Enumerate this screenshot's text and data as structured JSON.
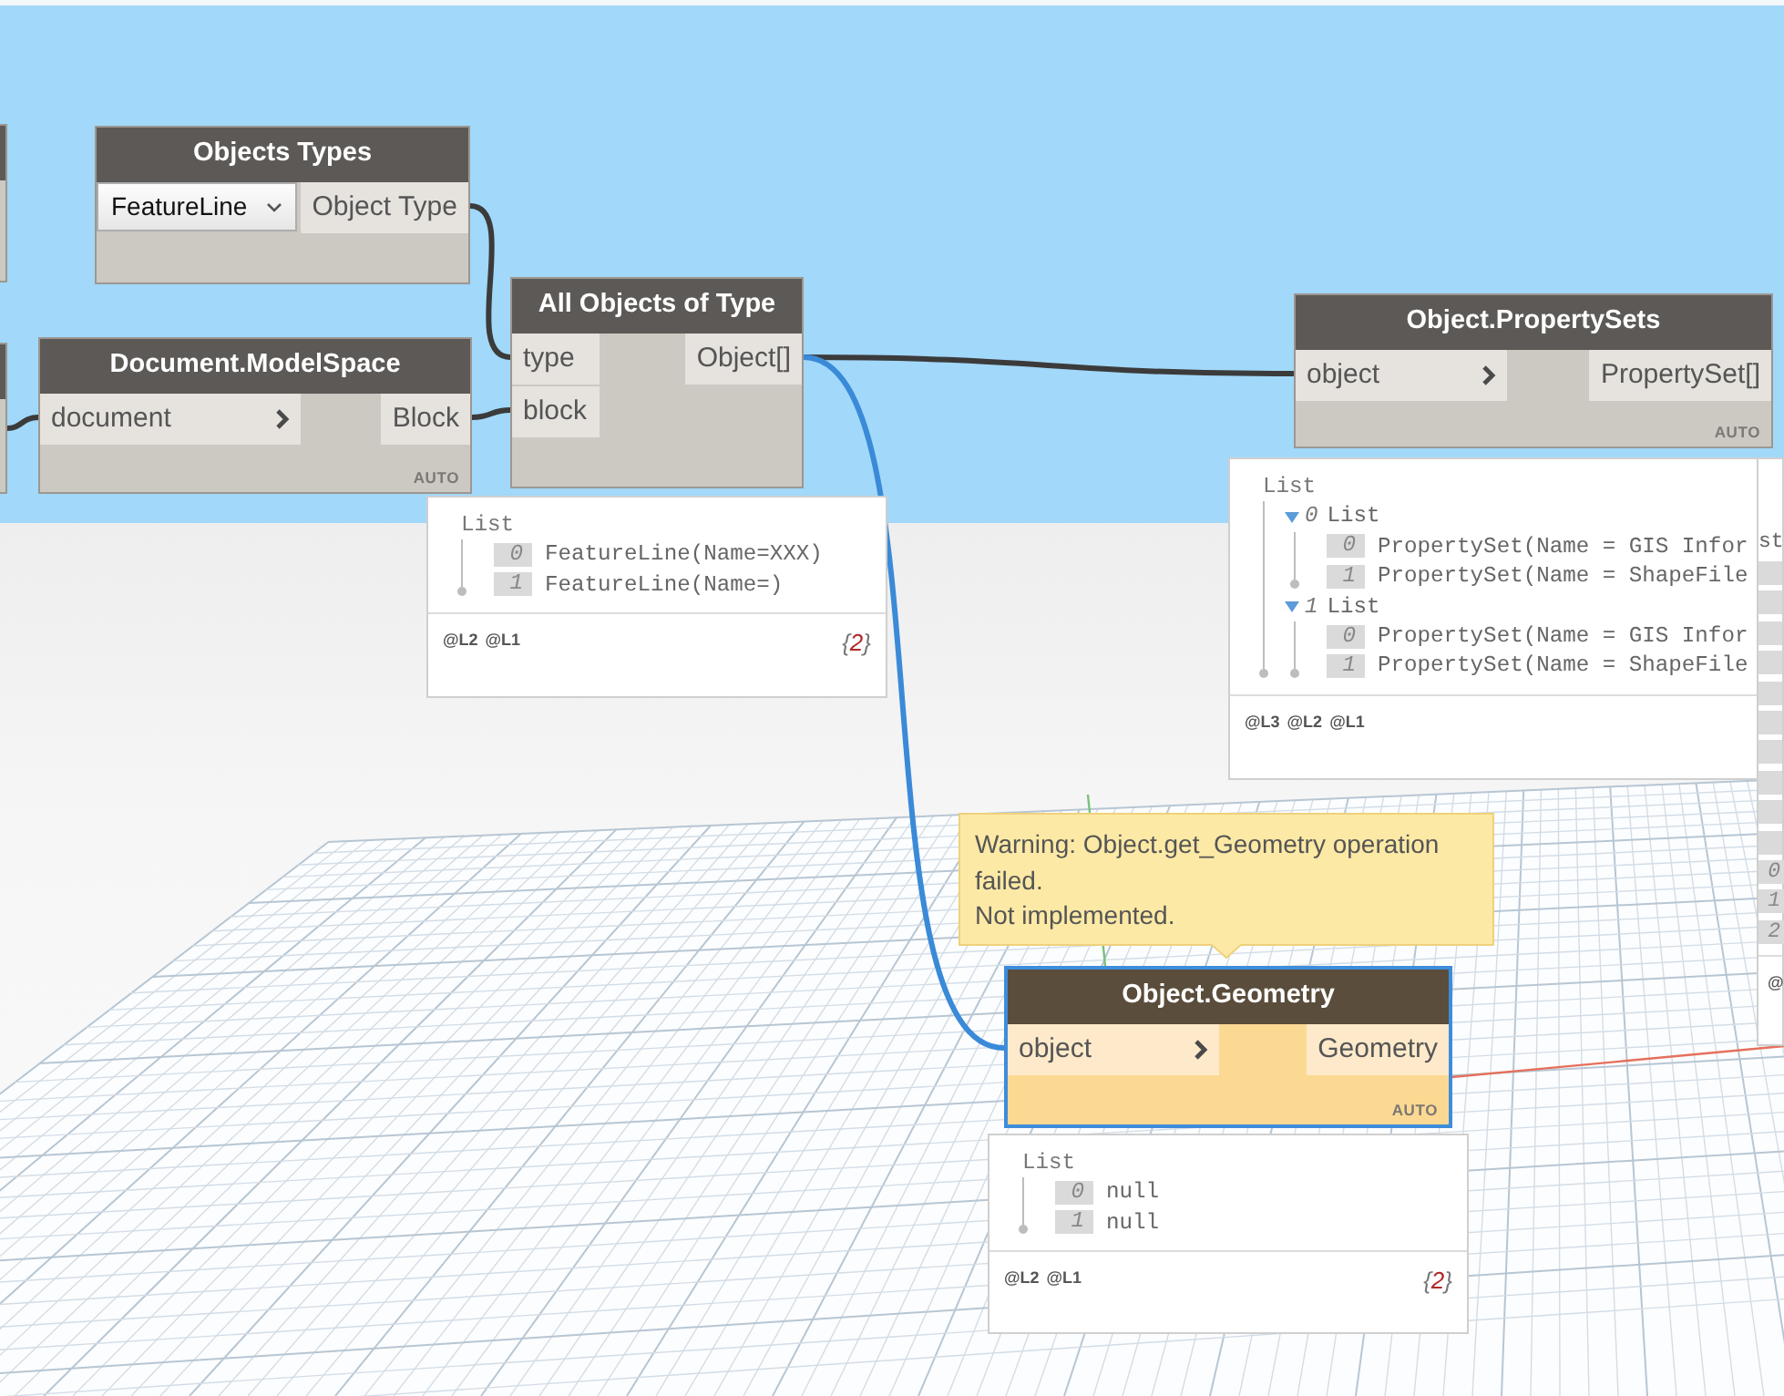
{
  "nodes": [
    {
      "kind": "dropdown",
      "title": "Objects Types",
      "selected": false,
      "warning": false,
      "dropdown": {
        "value": "FeatureLine"
      },
      "outputs": [
        "Object Type"
      ]
    },
    {
      "kind": "function",
      "title": "Document.ModelSpace",
      "selected": false,
      "warning": false,
      "inputs": [
        {
          "label": "document",
          "menu": true
        }
      ],
      "outputs": [
        "Block"
      ],
      "lacing": "AUTO"
    },
    {
      "kind": "function",
      "title": "All Objects of Type",
      "selected": false,
      "warning": false,
      "inputs": [
        {
          "label": "type",
          "menu": false
        },
        {
          "label": "block",
          "menu": false
        }
      ],
      "outputs": [
        "Object[]"
      ],
      "preview": {
        "root": "List",
        "items": [
          {
            "kind": "item",
            "index": "0",
            "value": "FeatureLine(Name=XXX)"
          },
          {
            "kind": "item",
            "index": "1",
            "value": "FeatureLine(Name=)"
          }
        ],
        "levels": [
          "@L2",
          "@L1"
        ],
        "count": {
          "open": "{",
          "value": "2",
          "close": "}"
        }
      }
    },
    {
      "kind": "function",
      "title": "Object.PropertySets",
      "selected": false,
      "warning": false,
      "inputs": [
        {
          "label": "object",
          "menu": true
        }
      ],
      "outputs": [
        "PropertySet[]"
      ],
      "lacing": "AUTO",
      "preview": {
        "root": "List",
        "items": [
          {
            "kind": "list",
            "index": "0",
            "label": "List",
            "expanded": true,
            "children": [
              {
                "kind": "item",
                "index": "0",
                "value": "PropertySet(Name = GIS Infor"
              },
              {
                "kind": "item",
                "index": "1",
                "value": "PropertySet(Name = ShapeFile"
              }
            ]
          },
          {
            "kind": "list",
            "index": "1",
            "label": "List",
            "expanded": true,
            "children": [
              {
                "kind": "item",
                "index": "0",
                "value": "PropertySet(Name = GIS Infor"
              },
              {
                "kind": "item",
                "index": "1",
                "value": "PropertySet(Name = ShapeFile"
              }
            ]
          }
        ],
        "levels": [
          "@L3",
          "@L2",
          "@L1"
        ]
      }
    },
    {
      "kind": "function",
      "title": "Object.Geometry",
      "selected": true,
      "warning": true,
      "warning_message": [
        "Warning: Object.get_Geometry operation failed.",
        "Not implemented."
      ],
      "inputs": [
        {
          "label": "object",
          "menu": true
        }
      ],
      "outputs": [
        "Geometry"
      ],
      "lacing": "AUTO",
      "preview": {
        "root": "List",
        "items": [
          {
            "kind": "item",
            "index": "0",
            "value": "null"
          },
          {
            "kind": "item",
            "index": "1",
            "value": "null"
          }
        ],
        "levels": [
          "@L2",
          "@L1"
        ],
        "count": {
          "open": "{",
          "value": "2",
          "close": "}"
        }
      }
    }
  ],
  "partial_preview": {
    "items": [
      {
        "kind": "text",
        "value": "st"
      },
      {
        "kind": "tile"
      },
      {
        "kind": "tile"
      },
      {
        "kind": "tile"
      },
      {
        "kind": "tile"
      },
      {
        "kind": "tile"
      },
      {
        "kind": "tile"
      },
      {
        "kind": "tile"
      },
      {
        "kind": "tile"
      },
      {
        "kind": "tile"
      },
      {
        "kind": "tile"
      },
      {
        "kind": "tile",
        "index": "0"
      },
      {
        "kind": "tile",
        "index": "1"
      },
      {
        "kind": "tile",
        "index": "2"
      }
    ],
    "levels": [
      "@"
    ]
  }
}
